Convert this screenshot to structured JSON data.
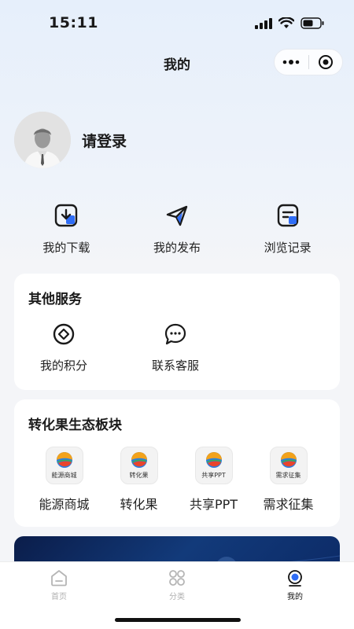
{
  "status": {
    "time": "15:11"
  },
  "nav": {
    "title": "我的"
  },
  "profile": {
    "login_text": "请登录"
  },
  "quick_actions": [
    {
      "label": "我的下载",
      "icon": "download-icon"
    },
    {
      "label": "我的发布",
      "icon": "send-icon"
    },
    {
      "label": "浏览记录",
      "icon": "history-icon"
    }
  ],
  "other_services": {
    "title": "其他服务",
    "items": [
      {
        "label": "我的积分",
        "icon": "points-icon"
      },
      {
        "label": "联系客服",
        "icon": "chat-icon"
      }
    ]
  },
  "ecosystem": {
    "title": "转化果生态板块",
    "items": [
      {
        "label": "能源商城",
        "logo_text": "能源商城"
      },
      {
        "label": "转化果",
        "logo_text": "转化果"
      },
      {
        "label": "共享PPT",
        "logo_text": "共享PPT"
      },
      {
        "label": "需求征集",
        "logo_text": "需求征集"
      }
    ]
  },
  "tabbar": {
    "items": [
      {
        "label": "首页",
        "icon": "home-icon",
        "active": false
      },
      {
        "label": "分类",
        "icon": "grid-icon",
        "active": false
      },
      {
        "label": "我的",
        "icon": "profile-icon",
        "active": true
      }
    ]
  },
  "colors": {
    "accent": "#2f6df6",
    "dark_text": "#1a1a1a"
  }
}
